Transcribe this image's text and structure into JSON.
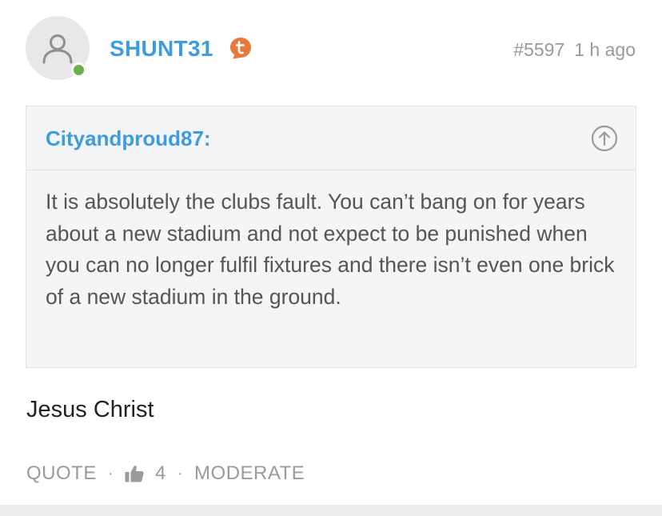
{
  "post": {
    "username": "SHUNT31",
    "badge_icon": "tapatalk-badge-icon",
    "post_number": "#5597",
    "time_ago": "1 h ago",
    "online": true,
    "online_color": "#6ab04c",
    "username_color": "#3d9be0"
  },
  "quote": {
    "author": "Cityandproud87:",
    "text": "It is absolutely the clubs fault. You can’t bang on for years about a new stadium and not expect to be punished when you can no longer fulfil fixtures and there isn’t even one brick of a new stadium in the ground.",
    "jump_icon": "arrow-up-circle-icon"
  },
  "body": {
    "text": "Jesus Christ"
  },
  "actions": {
    "quote_label": "QUOTE",
    "separator": "·",
    "like_icon": "thumbs-up-icon",
    "like_count": "4",
    "moderate_label": "MODERATE"
  }
}
